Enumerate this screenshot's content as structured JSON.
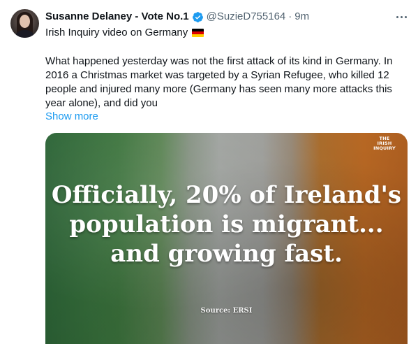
{
  "tweet": {
    "display_name": "Susanne Delaney - Vote No.1",
    "handle": "@SuzieD755164",
    "separator": "·",
    "time": "9m",
    "subtitle": "Irish Inquiry video on Germany",
    "body": "What happened yesterday was not the first attack of its kind in Germany. In 2016 a Christmas market was targeted by a Syrian Refugee, who killed 12 people and injured many more (Germany has seen many more attacks this year alone), and did you",
    "show_more": "Show more",
    "colors": {
      "link": "#1d9bf0",
      "verified": "#1d9bf0",
      "secondary_text": "#536471"
    }
  },
  "media": {
    "logo_lines": [
      "THE",
      "IRISH",
      "INQUIRY"
    ],
    "headline_lines": [
      "Officially, 20% of Ireland's",
      "population is migrant...",
      "and growing fast."
    ],
    "source": "Source: ERSI"
  },
  "icons": {
    "verified": "verified-badge-icon",
    "more": "more-options-icon",
    "flag": "germany-flag-icon"
  }
}
